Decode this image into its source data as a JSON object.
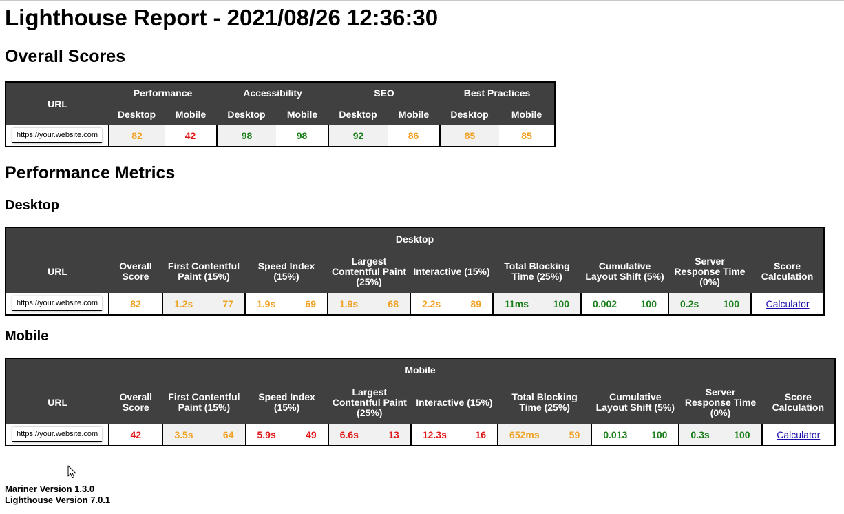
{
  "report": {
    "title": "Lighthouse Report - 2021/08/26 12:36:30"
  },
  "overall": {
    "heading": "Overall Scores",
    "url_header": "URL",
    "categories": [
      "Performance",
      "Accessibility",
      "SEO",
      "Best Practices"
    ],
    "device_labels": [
      "Desktop",
      "Mobile"
    ],
    "row": {
      "url": "https://your.website.com",
      "scores": [
        {
          "value": "82",
          "level": "avg"
        },
        {
          "value": "42",
          "level": "poor"
        },
        {
          "value": "98",
          "level": "good"
        },
        {
          "value": "98",
          "level": "good"
        },
        {
          "value": "92",
          "level": "good"
        },
        {
          "value": "86",
          "level": "avg"
        },
        {
          "value": "85",
          "level": "avg"
        },
        {
          "value": "85",
          "level": "avg"
        }
      ]
    }
  },
  "metrics": {
    "heading": "Performance Metrics",
    "headers": {
      "url": "URL",
      "overall": "Overall Score",
      "fcp": "First Contentful Paint (15%)",
      "si": "Speed Index (15%)",
      "lcp": "Largest Contentful Paint (25%)",
      "tti": "Interactive (15%)",
      "tbt": "Total Blocking Time (25%)",
      "cls": "Cumulative Layout Shift (5%)",
      "srt": "Server Response Time (0%)",
      "calc": "Score Calculation"
    },
    "desktop": {
      "heading": "Desktop",
      "caption": "Desktop",
      "url": "https://your.website.com",
      "overall": {
        "value": "82",
        "level": "avg"
      },
      "fcp": {
        "time": "1.2s",
        "score": "77",
        "level": "avg"
      },
      "si": {
        "time": "1.9s",
        "score": "69",
        "level": "avg"
      },
      "lcp": {
        "time": "1.9s",
        "score": "68",
        "level": "avg"
      },
      "tti": {
        "time": "2.2s",
        "score": "89",
        "level": "avg"
      },
      "tbt": {
        "time": "11ms",
        "score": "100",
        "level": "good"
      },
      "cls": {
        "time": "0.002",
        "score": "100",
        "level": "good"
      },
      "srt": {
        "time": "0.2s",
        "score": "100",
        "level": "good"
      },
      "calc": "Calculator"
    },
    "mobile": {
      "heading": "Mobile",
      "caption": "Mobile",
      "url": "https://your.website.com",
      "overall": {
        "value": "42",
        "level": "poor"
      },
      "fcp": {
        "time": "3.5s",
        "score": "64",
        "level": "avg"
      },
      "si": {
        "time": "5.9s",
        "score": "49",
        "level": "poor"
      },
      "lcp": {
        "time": "6.6s",
        "score": "13",
        "level": "poor"
      },
      "tti": {
        "time": "12.3s",
        "score": "16",
        "level": "poor"
      },
      "tbt": {
        "time": "652ms",
        "score": "59",
        "level": "avg"
      },
      "cls": {
        "time": "0.013",
        "score": "100",
        "level": "good"
      },
      "srt": {
        "time": "0.3s",
        "score": "100",
        "level": "good"
      },
      "calc": "Calculator"
    }
  },
  "footer": {
    "mariner": "Mariner Version 1.3.0",
    "lighthouse": "Lighthouse Version 7.0.1"
  },
  "colors": {
    "header_bg": "#404040",
    "good": "#1a7f1a",
    "average": "#f0a225",
    "poor": "#e01818",
    "shade": "#f1f1f1"
  }
}
